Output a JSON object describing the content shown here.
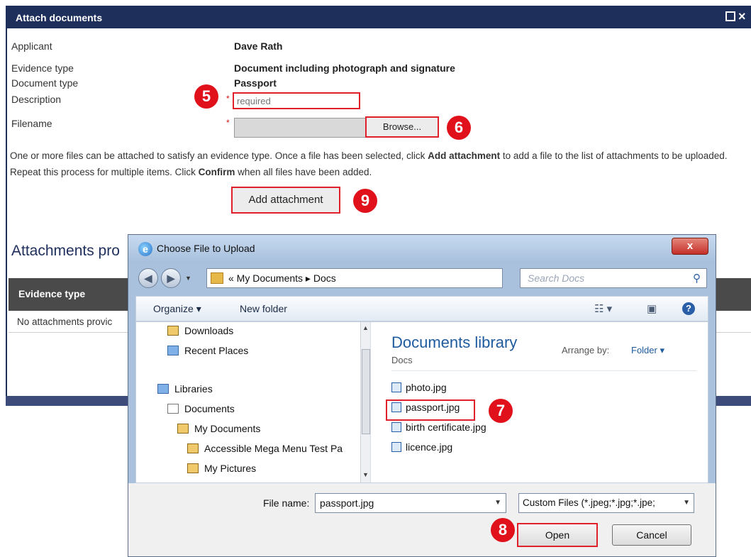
{
  "page": {
    "title": "Attach documents",
    "fields": {
      "applicant_label": "Applicant",
      "applicant_value": "Dave Rath",
      "evidence_type_label": "Evidence type",
      "evidence_type_value": "Document including photograph and signature",
      "document_type_label": "Document type",
      "document_type_value": "Passport",
      "description_label": "Description",
      "description_placeholder": "required",
      "filename_label": "Filename",
      "required_marker": "*"
    },
    "browse_label": "Browse...",
    "help_text": {
      "part1": "One or more files can be attached to satisfy an evidence type. Once a file has been selected, click ",
      "bold1": "Add attachment",
      "part2": " to add a file to the list of attachments to be uploaded. Repeat this process for multiple items. Click ",
      "bold2": "Confirm",
      "part3": " when all files have been added."
    },
    "add_attachment_label": "Add attachment",
    "attachments_heading": "Attachments pro",
    "table": {
      "column": "Evidence type",
      "empty_text": "No attachments provic"
    }
  },
  "markers": [
    "5",
    "6",
    "7",
    "8",
    "9"
  ],
  "dialog": {
    "title": "Choose File to Upload",
    "close_glyph": "x",
    "address": {
      "path": "« My Documents ▸ Docs",
      "search_placeholder": "Search Docs"
    },
    "toolbar": {
      "organize": "Organize ▾",
      "new_folder": "New folder"
    },
    "nav_items": [
      {
        "label": "Downloads"
      },
      {
        "label": "Recent Places"
      },
      {
        "label": "Libraries"
      },
      {
        "label": "Documents"
      },
      {
        "label": "My Documents"
      },
      {
        "label": "Accessible Mega Menu Test Pa"
      },
      {
        "label": "My Pictures"
      }
    ],
    "library": {
      "title": "Documents library",
      "subtitle": "Docs",
      "arrange_label": "Arrange by:",
      "arrange_value": "Folder ▾"
    },
    "files": [
      "photo.jpg",
      "passport.jpg",
      "birth certificate.jpg",
      "licence.jpg"
    ],
    "footer": {
      "file_name_label": "File name:",
      "file_name_value": "passport.jpg",
      "filter": "Custom Files (*.jpeg;*.jpg;*.jpe;",
      "open": "Open",
      "cancel": "Cancel"
    }
  },
  "colors": {
    "header_bg": "#1e2f5c",
    "highlight": "#e0202a",
    "marker": "#e0111a",
    "library_title": "#1e5b9e"
  }
}
